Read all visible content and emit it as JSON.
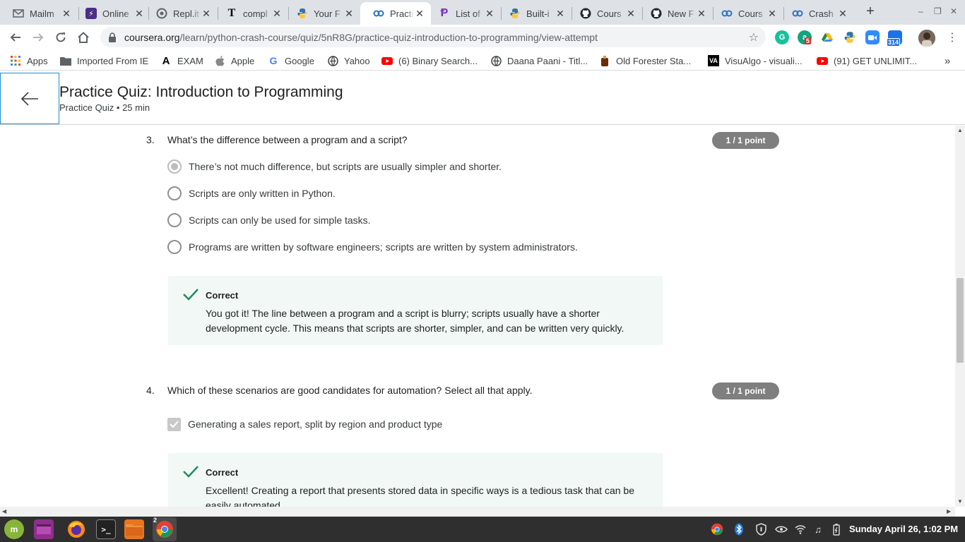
{
  "browser": {
    "tabs": [
      {
        "title": "Mailm",
        "icon": "mail-icon"
      },
      {
        "title": "Online",
        "icon": "bolt-icon"
      },
      {
        "title": "Repl.it",
        "icon": "replit-icon"
      },
      {
        "title": "compl",
        "icon": "t-icon"
      },
      {
        "title": "Your F",
        "icon": "python-icon"
      },
      {
        "title": "Practi",
        "icon": "coursera-icon",
        "active": true
      },
      {
        "title": "List of",
        "icon": "p-icon"
      },
      {
        "title": "Built-i",
        "icon": "python-icon"
      },
      {
        "title": "Cours",
        "icon": "github-icon"
      },
      {
        "title": "New F",
        "icon": "github-icon"
      },
      {
        "title": "Cours",
        "icon": "coursera-icon"
      },
      {
        "title": "Crash",
        "icon": "coursera-icon"
      }
    ],
    "address": {
      "host": "coursera.org",
      "path": "/learn/python-crash-course/quiz/5nR8G/practice-quiz-introduction-to-programming/view-attempt"
    },
    "extensions": {
      "grammarly_badge": "5",
      "calendar_badge": "314"
    },
    "bookmarks": [
      {
        "label": "Apps",
        "icon": "apps-grid-icon"
      },
      {
        "label": "Imported From IE",
        "icon": "folder-icon"
      },
      {
        "label": "EXAM",
        "icon": "exam-a-icon"
      },
      {
        "label": "Apple",
        "icon": "apple-icon"
      },
      {
        "label": "Google",
        "icon": "google-icon"
      },
      {
        "label": "Yahoo",
        "icon": "yahoo-icon"
      },
      {
        "label": "(6) Binary Search...",
        "icon": "youtube-icon"
      },
      {
        "label": "Daana Paani - Titl...",
        "icon": "globe-icon"
      },
      {
        "label": "Old Forester Sta...",
        "icon": "bottle-icon"
      },
      {
        "label": "VisuAlgo - visuali...",
        "icon": "visualgo-icon"
      },
      {
        "label": "(91) GET UNLIMIT...",
        "icon": "youtube-icon"
      }
    ]
  },
  "header": {
    "title": "Practice Quiz: Introduction to Programming",
    "subtitle": "Practice Quiz • 25 min"
  },
  "questions": [
    {
      "number": "3.",
      "text": "What’s the difference between a program and a script?",
      "points": "1 / 1 point",
      "options": [
        {
          "label": "There’s not much difference, but scripts are usually simpler and shorter.",
          "selected": true
        },
        {
          "label": "Scripts are only written in Python.",
          "selected": false
        },
        {
          "label": "Scripts can only be used for simple tasks.",
          "selected": false
        },
        {
          "label": "Programs are written by software engineers; scripts are written by system administrators.",
          "selected": false
        }
      ],
      "feedback": {
        "label": "Correct",
        "text": "You got it! The line between a program and a script is blurry; scripts usually have a shorter development cycle. This means that scripts are shorter, simpler, and can be written very quickly."
      }
    },
    {
      "number": "4.",
      "text": "Which of these scenarios are good candidates for automation? Select all that apply.",
      "points": "1 / 1 point",
      "options": [
        {
          "label": "Generating a sales report, split by region and product type",
          "selected": true
        }
      ],
      "feedback": {
        "label": "Correct",
        "text": "Excellent! Creating a report that presents stored data in specific ways is a tedious task that can be easily automated."
      }
    }
  ],
  "taskbar": {
    "clock": "Sunday April 26, 1:02 PM",
    "chrome_badge": "2"
  },
  "colors": {
    "correct_green": "#1e8a5a",
    "feedback_bg": "#f1f8f5",
    "points_pill": "#7f7f7f",
    "focus_blue": "#1f8dd6"
  }
}
